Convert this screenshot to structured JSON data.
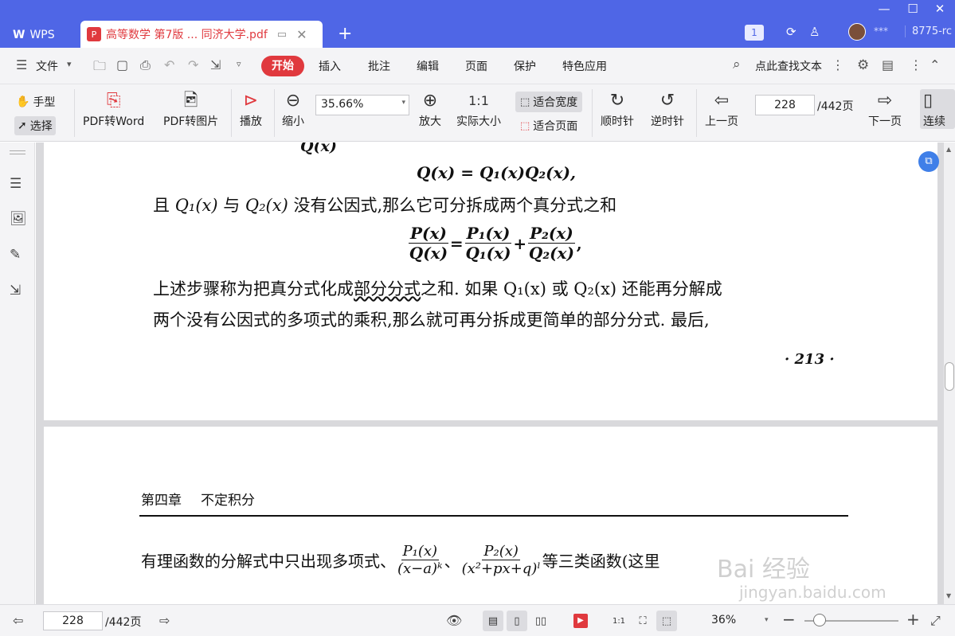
{
  "titlebar": {
    "app_tab": "WPS",
    "doc_tab": "高等数学 第7版 ... 同济大学.pdf",
    "badge": "1",
    "user_masked": "***",
    "user_id": "8775-rc"
  },
  "menubar": {
    "file": "文件",
    "start": "开始",
    "items": [
      "插入",
      "批注",
      "编辑",
      "页面",
      "保护",
      "特色应用"
    ],
    "search": "点此查找文本"
  },
  "toolbar": {
    "hand": "手型",
    "select": "选择",
    "pdf_to_word": "PDF转Word",
    "pdf_to_image": "PDF转图片",
    "play": "播放",
    "zoom_out": "缩小",
    "zoom_value": "35.66%",
    "zoom_in": "放大",
    "actual_size": "实际大小",
    "fit_width": "适合宽度",
    "fit_page": "适合页面",
    "rotate_cw": "顺时针",
    "rotate_ccw": "逆时针",
    "prev_page": "上一页",
    "current_page": "228",
    "total_pages": "/442页",
    "next_page": "下一页",
    "continuous": "连续"
  },
  "document": {
    "page1": {
      "top_partial": "Q(x)",
      "eq1": "Q(x) = Q₁(x)Q₂(x),",
      "line1_a": "且 ",
      "line1_q1": "Q₁(x)",
      "line1_b": " 与 ",
      "line1_q2": "Q₂(x)",
      "line1_c": " 没有公因式,那么它可分拆成两个真分式之和",
      "frac_lhs_num": "P(x)",
      "frac_lhs_den": "Q(x)",
      "frac_r1_num": "P₁(x)",
      "frac_r1_den": "Q₁(x)",
      "frac_r2_num": "P₂(x)",
      "frac_r2_den": "Q₂(x)",
      "line2_a": "上述步骤称为把真分式化成",
      "line2_term": "部分分式",
      "line2_b": "之和. 如果 Q₁(x) 或 Q₂(x) 还能再分解成",
      "line3": "两个没有公因式的多项式的乘积,那么就可再分拆成更简单的部分分式. 最后,",
      "page_number": "· 213 ·"
    },
    "page2": {
      "chapter": "第四章",
      "chapter_title": "不定积分",
      "line1_a": "有理函数的分解式中只出现多项式、",
      "f1_num": "P₁(x)",
      "f1_den": "(x−a)ᵏ",
      "f2_num": "P₂(x)",
      "f2_den": "(x²+px+q)ˡ",
      "line1_b": "等三类函数(这里"
    }
  },
  "statusbar": {
    "current_page": "228",
    "total_pages": "/442页",
    "zoom": "36%"
  },
  "watermark": {
    "text": "Bai 经验",
    "url": "jingyan.baidu.com"
  }
}
